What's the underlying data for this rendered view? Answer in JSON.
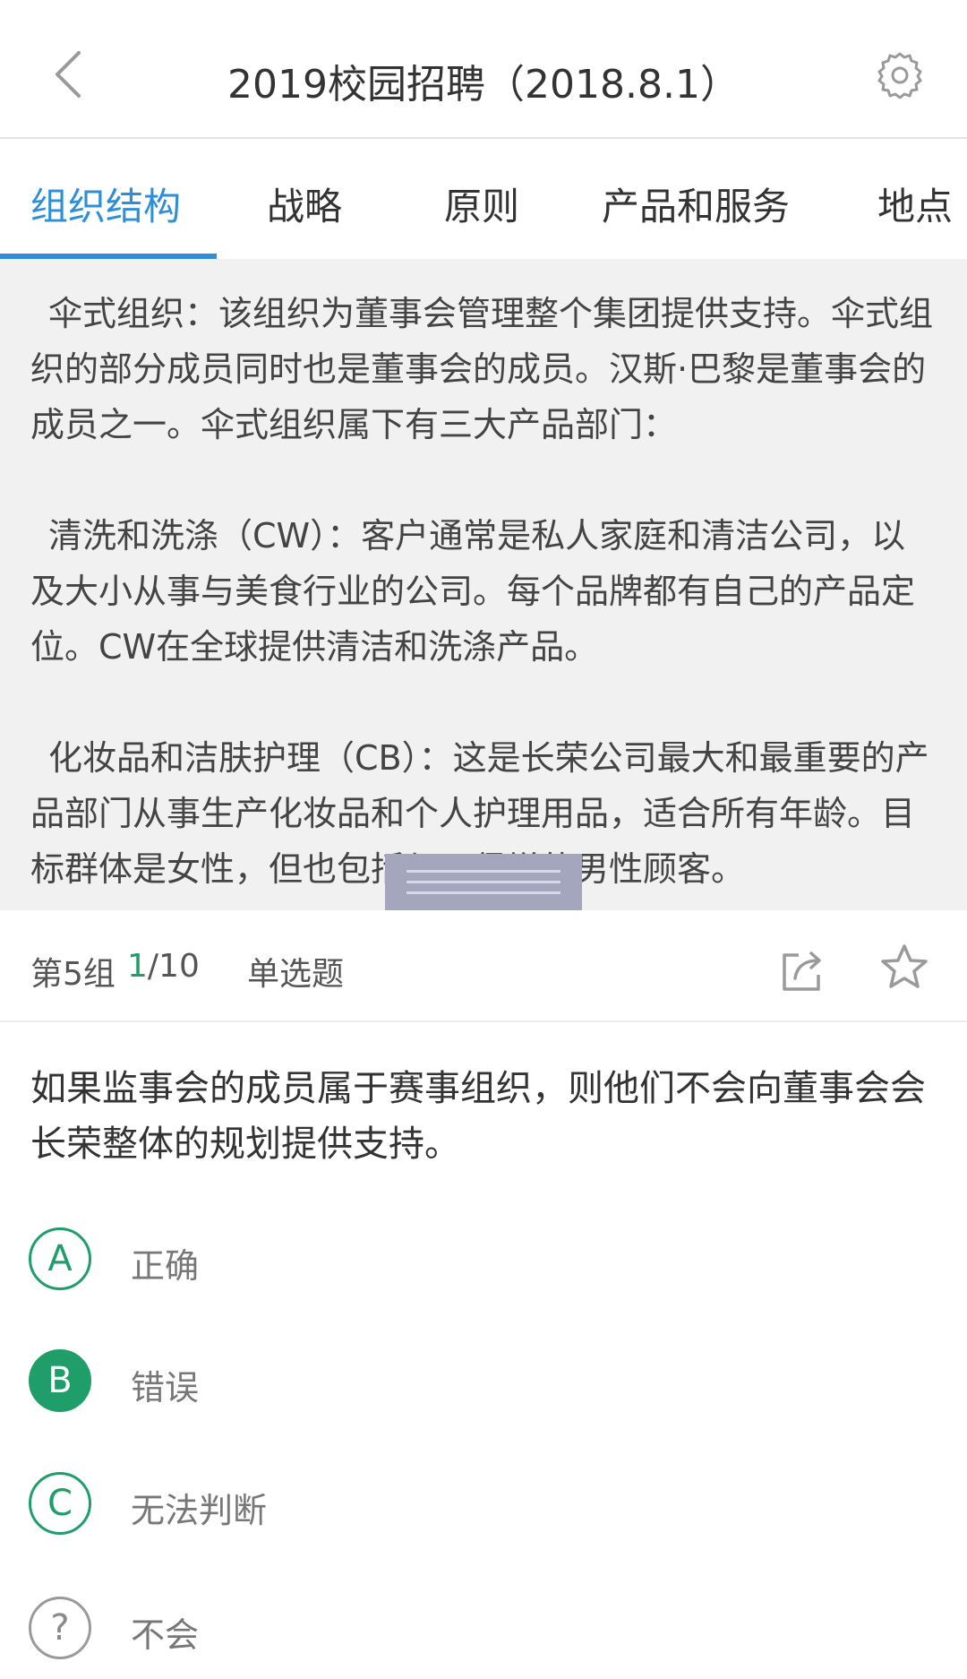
{
  "header": {
    "title": "2019校园招聘（2018.8.1）",
    "back_icon": "chevron-left-icon",
    "settings_icon": "gear-icon"
  },
  "tabs": [
    {
      "label": "组织结构",
      "active": true
    },
    {
      "label": "战略",
      "active": false
    },
    {
      "label": "原则",
      "active": false
    },
    {
      "label": "产品和服务",
      "active": false
    },
    {
      "label": "地点",
      "active": false
    }
  ],
  "passage": {
    "paragraphs": [
      "伞式组织：该组织为董事会管理整个集团提供支持。伞式组织的部分成员同时也是董事会的成员。汉斯·巴黎是董事会的成员之一。伞式组织属下有三大产品部门：",
      "清洗和洗涤（CW）：客户通常是私人家庭和清洁公司，以及大小从事与美食行业的公司。每个品牌都有自己的产品定位。CW在全球提供清洁和洗涤产品。",
      "化妆品和洁肤护理（CB）：这是长荣公司最大和最重要的产品部门从事生产化妆品和个人护理用品，适合所有年龄。目标群体是女性，但也包括与日俱增的男性顾客。"
    ]
  },
  "meta": {
    "group": "第5组",
    "current": "1",
    "total": "/10",
    "type": "单选题",
    "share_icon": "share-icon",
    "star_icon": "star-icon"
  },
  "question": {
    "text": "如果监事会的成员属于赛事组织，则他们不会向董事会会长荣整体的规划提供支持。"
  },
  "options": [
    {
      "letter": "A",
      "label": "正确",
      "selected": false
    },
    {
      "letter": "B",
      "label": "错误",
      "selected": true
    },
    {
      "letter": "C",
      "label": "无法判断",
      "selected": false
    },
    {
      "letter": "?",
      "label": "不会",
      "selected": false
    }
  ],
  "colors": {
    "accent_blue": "#2f8fd6",
    "accent_green": "#1f9e6a",
    "passage_bg": "#f1f1f1"
  }
}
